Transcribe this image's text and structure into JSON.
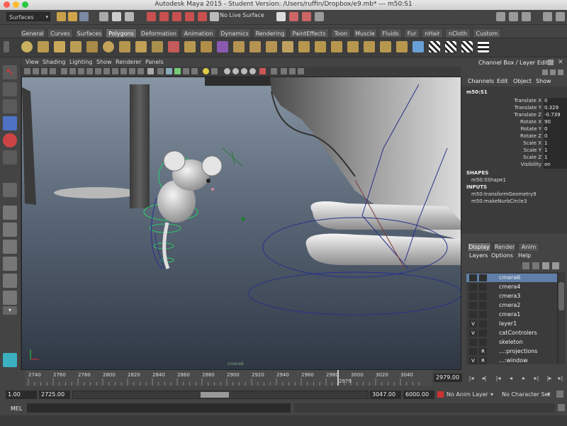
{
  "window": {
    "title": "Autodesk Maya 2015 - Student Version: /Users/ruffin/Dropbox/e9.mb*   ---   m50:S1"
  },
  "status_line": {
    "menu_set": "Surfaces",
    "live_surface": "No Live Surface"
  },
  "shelf": {
    "tabs": [
      "General",
      "Curves",
      "Surfaces",
      "Polygons",
      "Deformation",
      "Animation",
      "Dynamics",
      "Rendering",
      "PaintEffects",
      "Toon",
      "Muscle",
      "Fluids",
      "Fur",
      "nHair",
      "nCloth",
      "Custom"
    ],
    "active_tab": "Polygons"
  },
  "panel": {
    "menus": [
      "View",
      "Shading",
      "Lighting",
      "Show",
      "Renderer",
      "Panels"
    ],
    "camera_label": "cmera6"
  },
  "channel_box": {
    "title": "Channel Box / Layer Editor",
    "menus": [
      "Channels",
      "Edit",
      "Object",
      "Show"
    ],
    "object": "m50:S1",
    "attributes": [
      {
        "name": "Translate X",
        "value": "0"
      },
      {
        "name": "Translate Y",
        "value": "0.329"
      },
      {
        "name": "Translate Z",
        "value": "-0.739"
      },
      {
        "name": "Rotate X",
        "value": "90"
      },
      {
        "name": "Rotate Y",
        "value": "0"
      },
      {
        "name": "Rotate Z",
        "value": "0"
      },
      {
        "name": "Scale X",
        "value": "1"
      },
      {
        "name": "Scale Y",
        "value": "1"
      },
      {
        "name": "Scale Z",
        "value": "1"
      },
      {
        "name": "Visibility",
        "value": "on"
      }
    ],
    "shapes_label": "SHAPES",
    "shape": "m50:SShape1",
    "inputs_label": "INPUTS",
    "inputs": [
      "m50:transformGeometry9",
      "m50:makeNurbCircle3"
    ]
  },
  "layer_editor": {
    "tabs": [
      "Display",
      "Render",
      "Anim"
    ],
    "active_tab": "Display",
    "menus": [
      "Layers",
      "Options",
      "Help"
    ],
    "layers": [
      {
        "v": "",
        "p": "",
        "name": "cmera6",
        "selected": true
      },
      {
        "v": "",
        "p": "",
        "name": "cmera4",
        "selected": false
      },
      {
        "v": "",
        "p": "",
        "name": "cmera3",
        "selected": false
      },
      {
        "v": "",
        "p": "",
        "name": "cmera2",
        "selected": false
      },
      {
        "v": "",
        "p": "",
        "name": "cmera1",
        "selected": false
      },
      {
        "v": "V",
        "p": "",
        "name": "layer1",
        "selected": false
      },
      {
        "v": "V",
        "p": "",
        "name": "catControlers",
        "selected": false
      },
      {
        "v": "",
        "p": "",
        "name": "skeleton",
        "selected": false
      },
      {
        "v": "",
        "p": "R",
        "name": "...:projections",
        "selected": false
      },
      {
        "v": "V",
        "p": "R",
        "name": "...:window",
        "selected": false
      }
    ]
  },
  "time_slider": {
    "ticks": [
      "2740",
      "2760",
      "2780",
      "2800",
      "2820",
      "2840",
      "2860",
      "2880",
      "2900",
      "2920",
      "2940",
      "2960",
      "2980",
      "3000",
      "3020",
      "3040"
    ],
    "current_frame_label": "2979",
    "current_frame": "2979.00"
  },
  "range_slider": {
    "start_a": "1.00",
    "start_b": "2725.00",
    "end_a": "3047.00",
    "end_b": "6000.00",
    "anim_layer": "No Anim Layer",
    "character_set": "No Character Set"
  },
  "command_line": {
    "label": "MEL"
  },
  "colors": {
    "accent_selection": "#5f7fa8",
    "panel_bg": "#444444"
  }
}
